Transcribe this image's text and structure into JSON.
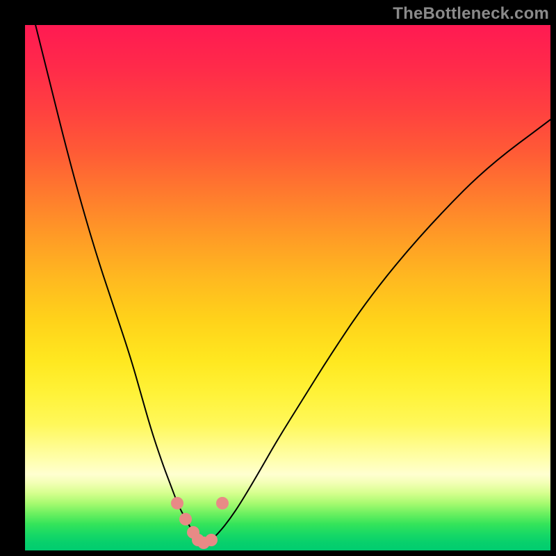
{
  "watermark": "TheBottleneck.com",
  "chart_data": {
    "type": "line",
    "title": "",
    "xlabel": "",
    "ylabel": "",
    "xlim": [
      0,
      100
    ],
    "ylim": [
      0,
      100
    ],
    "grid": false,
    "legend": false,
    "series": [
      {
        "name": "bottleneck-curve",
        "x": [
          2,
          5,
          8,
          11,
          14,
          17,
          20,
          22,
          24,
          26,
          27.5,
          29,
          30.5,
          32,
          33,
          34,
          35.5,
          37,
          39,
          41,
          44,
          48,
          53,
          58,
          64,
          71,
          79,
          88,
          100
        ],
        "y": [
          100,
          88,
          76,
          65,
          55,
          46,
          37,
          30,
          23,
          17,
          13,
          9,
          6,
          3.5,
          2,
          1.5,
          2,
          3.5,
          6,
          9,
          14,
          21,
          29,
          37,
          46,
          55,
          64,
          73,
          82
        ]
      }
    ],
    "markers": [
      {
        "name": "dot-left-upper",
        "x": 29.0,
        "y": 9.0
      },
      {
        "name": "dot-left-lower",
        "x": 30.5,
        "y": 6.0
      },
      {
        "name": "dot-valley-1",
        "x": 32.0,
        "y": 3.5
      },
      {
        "name": "dot-valley-2",
        "x": 33.0,
        "y": 2.0
      },
      {
        "name": "dot-valley-3",
        "x": 34.0,
        "y": 1.5
      },
      {
        "name": "dot-valley-4",
        "x": 35.5,
        "y": 2.0
      },
      {
        "name": "dot-right-upper",
        "x": 37.5,
        "y": 9.0
      }
    ],
    "gradient_stops": [
      {
        "pos": 0.0,
        "color": "#ff1a52"
      },
      {
        "pos": 0.5,
        "color": "#ffd21a"
      },
      {
        "pos": 0.83,
        "color": "#ffffb0"
      },
      {
        "pos": 1.0,
        "color": "#00cc70"
      }
    ]
  }
}
